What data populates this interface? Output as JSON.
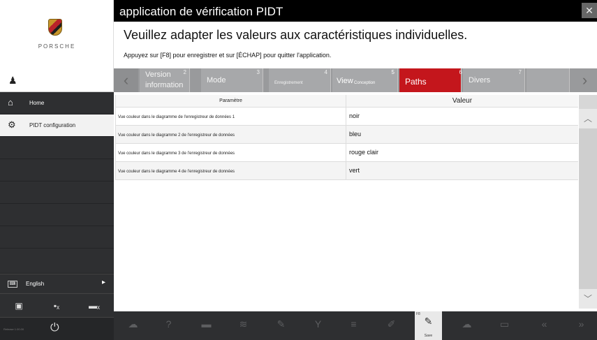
{
  "app": {
    "title": "application de vérification PIDT",
    "close_glyph": "✕",
    "subtitle": "Veuillez adapter les valeurs aux caractéristiques individuelles.",
    "hint": "Appuyez sur [F8] pour enregistrer et sur [ÉCHAP] pour quitter l'application."
  },
  "sidebar": {
    "brand": "PORSCHE",
    "user_icon": "person-icon",
    "items": [
      {
        "label": "Home",
        "icon": "home-icon"
      },
      {
        "label": "PIDT configuration",
        "icon": "gear-icon"
      }
    ],
    "language": {
      "label": "English",
      "kbd": "⌨"
    },
    "tools": [
      "battery-icon",
      "device-disconnected-icon",
      "device-disconnected-icon-2"
    ],
    "version": "Release 1.00.00",
    "power": "⏻"
  },
  "tabs": {
    "prev": "‹",
    "next": "›",
    "items": [
      {
        "num": "2",
        "label": "Version information"
      },
      {
        "num": "3",
        "label": "Mode"
      },
      {
        "num": "4",
        "label": "Enregistrement"
      },
      {
        "num": "5",
        "label": "View",
        "sub": "Conception"
      },
      {
        "num": "",
        "label": "Paths"
      },
      {
        "num": "6",
        "label": "Divers"
      },
      {
        "num": "7",
        "label": ""
      }
    ]
  },
  "table": {
    "headers": {
      "param": "Paramètre",
      "value": "Valeur"
    },
    "rows": [
      {
        "param": "Vue couleur dans le diagramme de l'enregistreur de données 1",
        "value": "noir"
      },
      {
        "param": "Vue couleur dans le diagramme 2 de l'enregistreur de données",
        "value": "bleu"
      },
      {
        "param": "Vue couleur dans le diagramme 3 de l'enregistreur de données",
        "value": "rouge clair"
      },
      {
        "param": "Vue couleur dans le diagramme 4 de l'enregistreur de données",
        "value": "vert"
      }
    ]
  },
  "scroll": {
    "up": "︿",
    "down": "﹀"
  },
  "toolbar": {
    "keys": [
      {
        "icon": "cloud-icon",
        "glyph": "☁"
      },
      {
        "icon": "help-icon",
        "glyph": "?"
      },
      {
        "icon": "list-icon",
        "glyph": "▬"
      },
      {
        "icon": "chart-icon",
        "glyph": "≋"
      },
      {
        "icon": "edit-icon",
        "glyph": "✎"
      },
      {
        "icon": "filter-icon",
        "glyph": "Y"
      },
      {
        "icon": "table-icon",
        "glyph": "≡"
      },
      {
        "icon": "tools-icon",
        "glyph": "✐"
      },
      {
        "icon": "save-icon",
        "glyph": "✎",
        "fn": "F8",
        "caption": "Save",
        "active": true
      },
      {
        "icon": "cloud-icon",
        "glyph": "☁"
      },
      {
        "icon": "print-icon",
        "glyph": "▭"
      },
      {
        "icon": "rewind-icon",
        "glyph": "«"
      },
      {
        "icon": "forward-icon",
        "glyph": "»"
      }
    ]
  },
  "colors": {
    "accent": "#c4161c",
    "sidebar": "#2e2f31",
    "tabbar": "#999a9c"
  }
}
